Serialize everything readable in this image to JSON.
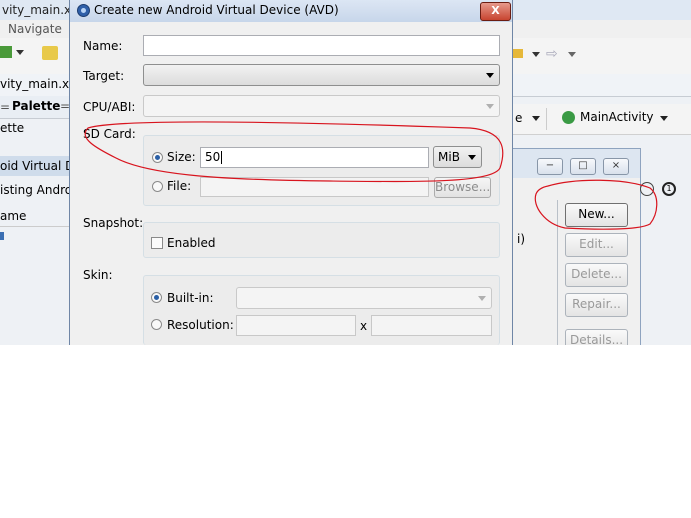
{
  "background_app": {
    "title": "vity_main.xml - Eclip",
    "menu_item": "Navigate",
    "editor_tab": "vity_main.xml",
    "palette_label": "Palette",
    "palette_row": "ette",
    "avd_manager_title": "oid Virtual Devi",
    "avd_list_label": "isting Androi",
    "column_name": "ame",
    "row_fragment": "i)",
    "right_toolbar": {
      "device_fragment": "e",
      "activity_label": "MainActivity"
    },
    "avd_buttons": {
      "new": "New...",
      "edit": "Edit...",
      "delete": "Delete...",
      "repair": "Repair...",
      "details": "Details..."
    }
  },
  "dialog": {
    "title": "Create new Android Virtual Device (AVD)",
    "close_label": "X",
    "name_label": "Name:",
    "name_value": "",
    "target_label": "Target:",
    "target_value": "",
    "cpu_label": "CPU/ABI:",
    "cpu_value": "",
    "sdcard_label": "SD Card:",
    "size_label": "Size:",
    "size_value": "50",
    "size_unit": "MiB",
    "file_label": "File:",
    "file_value": "",
    "browse_label": "Browse...",
    "snapshot_label": "Snapshot:",
    "enabled_label": "Enabled",
    "skin_label": "Skin:",
    "builtin_label": "Built-in:",
    "resolution_label": "Resolution:",
    "resolution_separator": "x"
  },
  "colors": {
    "annotation": "#d8141e",
    "close_button": "#c74530",
    "title_bar": "#c7d6ea"
  }
}
